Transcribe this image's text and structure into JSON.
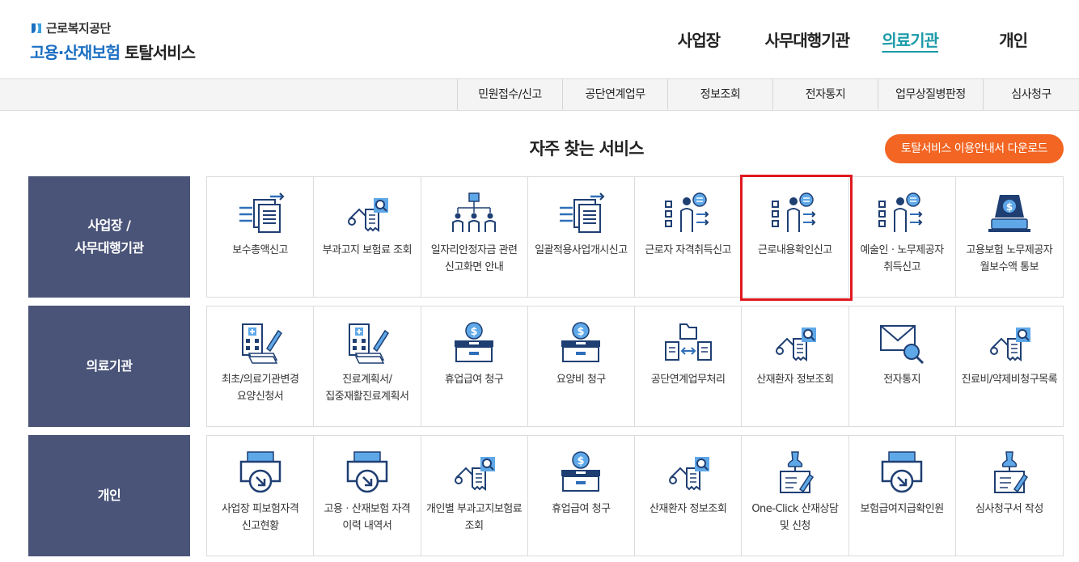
{
  "logo": {
    "org": "근로복지공단",
    "title_blue": "고용·산재보험",
    "title_dark": "토탈서비스"
  },
  "topnav": [
    "사업장",
    "사무대행기관",
    "의료기관",
    "개인"
  ],
  "topnav_active": "의료기관",
  "subnav": [
    "민원접수/신고",
    "공단연계업무",
    "정보조회",
    "전자통지",
    "업무상질병판정",
    "심사청구"
  ],
  "section_title": "자주 찾는 서비스",
  "download_button": "토탈서비스 이용안내서 다운로드",
  "colors": {
    "brand": "#1b6fc2",
    "active": "#1a9aa8",
    "label_bg": "#4a5478",
    "icon_blue": "#2f6fba",
    "download": "#f26522",
    "highlight": "#e0181f"
  },
  "rows": [
    {
      "label": "사업장 /\n사무대행기관",
      "items": [
        {
          "label": "보수총액신고",
          "icon": "document-transfer-icon"
        },
        {
          "label": "부과고지 보험료 조회",
          "icon": "document-search-icon"
        },
        {
          "label": "일자리안정자금 관련 신고화면 안내",
          "icon": "org-chart-icon"
        },
        {
          "label": "일괄적용사업개시신고",
          "icon": "document-transfer-icon"
        },
        {
          "label": "근로자 자격취득신고",
          "icon": "person-checklist-icon"
        },
        {
          "label": "근로내용확인신고",
          "icon": "person-checklist-icon",
          "highlight": true
        },
        {
          "label": "예술인ㆍ노무제공자 취득신고",
          "icon": "person-checklist-icon"
        },
        {
          "label": "고용보험 노무제공자 월보수액 통보",
          "icon": "money-laptop-icon"
        }
      ]
    },
    {
      "label": "의료기관",
      "items": [
        {
          "label": "최초/의료기관변경 요양신청서",
          "icon": "hospital-document-icon"
        },
        {
          "label": "진료계획서/집중재활진료계획서",
          "icon": "hospital-document-icon"
        },
        {
          "label": "휴업급여 청구",
          "icon": "money-box-icon"
        },
        {
          "label": "요양비 청구",
          "icon": "money-box-icon"
        },
        {
          "label": "공단연계업무처리",
          "icon": "folder-exchange-icon"
        },
        {
          "label": "산재환자 정보조회",
          "icon": "document-search-icon"
        },
        {
          "label": "전자통지",
          "icon": "mail-search-icon"
        },
        {
          "label": "진료비/약제비청구목록",
          "icon": "document-search-icon"
        }
      ]
    },
    {
      "label": "개인",
      "items": [
        {
          "label": "사업장 피보험자격 신고현황",
          "icon": "printer-download-icon"
        },
        {
          "label": "고용ㆍ산재보험 자격 이력 내역서",
          "icon": "printer-download-icon"
        },
        {
          "label": "개인별 부과고지보험료 조회",
          "icon": "document-search-icon"
        },
        {
          "label": "휴업급여 청구",
          "icon": "money-box-icon"
        },
        {
          "label": "산재환자 정보조회",
          "icon": "document-search-icon"
        },
        {
          "label": "One-Click 산재상담 및 신청",
          "icon": "pin-document-icon"
        },
        {
          "label": "보험급여지급확인원",
          "icon": "printer-download-icon"
        },
        {
          "label": "심사청구서 작성",
          "icon": "pin-document-icon"
        }
      ]
    }
  ]
}
